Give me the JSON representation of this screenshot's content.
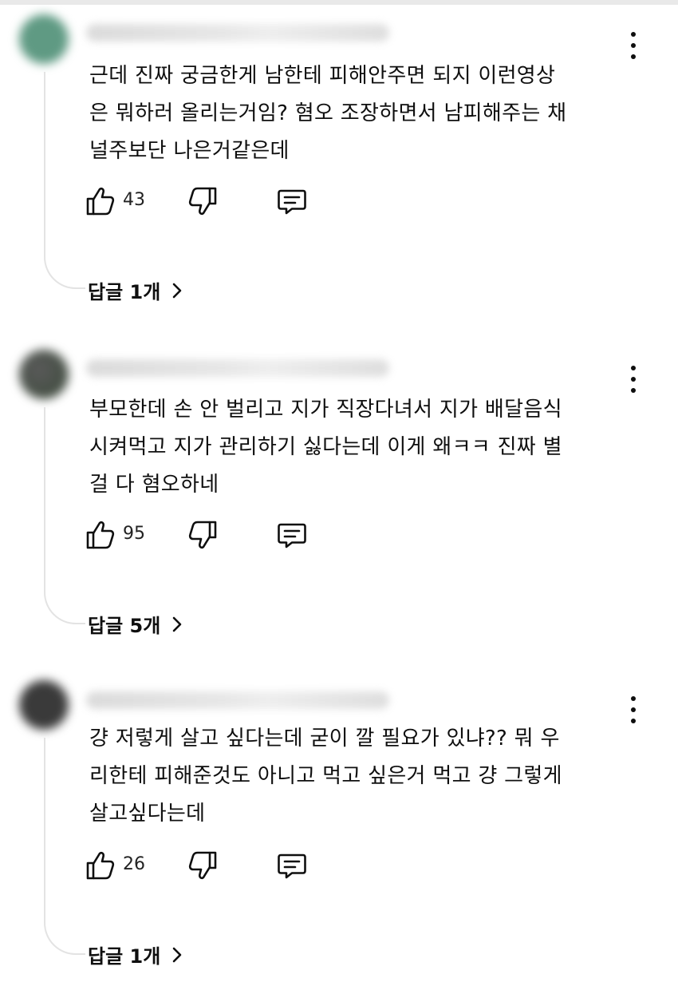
{
  "comments": [
    {
      "avatar_color": "#5f9a83",
      "text": "근데 진짜 궁금한게 남한테 피해안주면 되지 이런영상\n은 뭐하러 올리는거임? 혐오 조장하면서 남피해주는 채\n널주보단 나은거같은데",
      "likes": "43",
      "replies_label": "답글 1개"
    },
    {
      "avatar_color": "#4a4a4a",
      "text": "부모한데 손 안 벌리고 지가 직장다녀서 지가 배달음식\n시켜먹고 지가 관리하기 싫다는데 이게 왜ㅋㅋ 진짜 별\n걸 다 혐오하네",
      "likes": "95",
      "replies_label": "답글 5개"
    },
    {
      "avatar_color": "#3a3a3a",
      "text": "걍 저렇게 살고 싶다는데 굳이 깔 필요가 있냐?? 뭐 우\n리한테 피해준것도 아니고 먹고 싶은거 먹고 걍 그렇게\n살고싶다는데",
      "likes": "26",
      "replies_label": "답글 1개"
    }
  ],
  "icons": {
    "like": "thumbs-up-icon",
    "dislike": "thumbs-down-icon",
    "reply": "comment-reply-icon",
    "menu": "more-vert-icon",
    "chevron": "chevron-right-icon"
  }
}
